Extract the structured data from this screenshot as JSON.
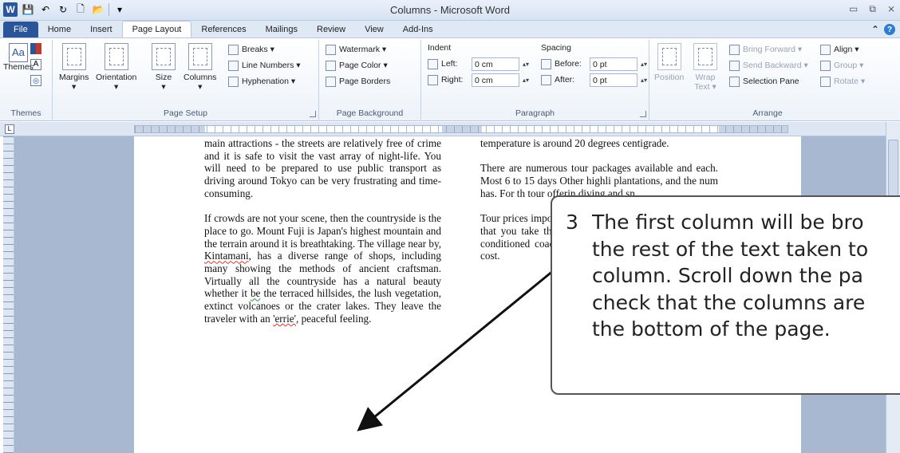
{
  "window": {
    "title": "Columns - Microsoft Word",
    "app_icon": "W"
  },
  "tabs": [
    "File",
    "Home",
    "Insert",
    "Page Layout",
    "References",
    "Mailings",
    "Review",
    "View",
    "Add-Ins"
  ],
  "active_tab": "Page Layout",
  "ribbon": {
    "themes": {
      "label": "Themes",
      "group": "Themes"
    },
    "page_setup": {
      "group": "Page Setup",
      "margins": "Margins",
      "orientation": "Orientation",
      "size": "Size",
      "columns": "Columns",
      "breaks": "Breaks ▾",
      "line_numbers": "Line Numbers ▾",
      "hyphenation": "Hyphenation ▾"
    },
    "page_background": {
      "group": "Page Background",
      "watermark": "Watermark ▾",
      "page_color": "Page Color ▾",
      "page_borders": "Page Borders"
    },
    "paragraph": {
      "group": "Paragraph",
      "indent": "Indent",
      "left_label": "Left:",
      "left_value": "0 cm",
      "right_label": "Right:",
      "right_value": "0 cm",
      "spacing": "Spacing",
      "before_label": "Before:",
      "before_value": "0 pt",
      "after_label": "After:",
      "after_value": "0 pt"
    },
    "arrange": {
      "group": "Arrange",
      "position": "Position",
      "wrap_text": "Wrap Text ▾",
      "bring_forward": "Bring Forward ▾",
      "send_backward": "Send Backward ▾",
      "selection_pane": "Selection Pane",
      "align": "Align ▾",
      "group_btn": "Group ▾",
      "rotate": "Rotate ▾"
    }
  },
  "document": {
    "col1": {
      "p1": "main attractions - the streets are relatively free of crime and it is safe to visit the vast array of night-life.  You will need to be prepared to use public transport as driving around Tokyo can be very frustrating and time-consuming.",
      "p2a": "If crowds are not your scene, then the countryside is the place to go.  Mount Fuji is Japan's highest mountain and the terrain around it is breathtaking.  The village near by, ",
      "p2_kintamani": "Kintamani",
      "p2b": ", has a diverse range of shops, including many showing the methods of ancient craftsman.  Virtually all the countryside has a natural beauty whether it ",
      "p2_be": "be",
      "p2c": " the terraced hillsides, the lush vegetation, extinct volcanoes or the crater lakes.  They leave the traveler with an ",
      "p2_errie": "'errie'",
      "p2d": ", peaceful feeling."
    },
    "col2": {
      "p1": "temperature is around 20 degrees centigrade.",
      "p2": "There are numerous tour packages available and each.  Most 6 to 15 days Other highli plantations, and the num has.  For th tour offerin diving and sn",
      "p3": "Tour prices important to read each brochure carefully so that you take the tour you want.  For instance, an air conditioned coach can add up to 30% on to the tour cost."
    }
  },
  "callout": {
    "number": "3",
    "lines": [
      "The first column will be bro",
      "the rest of the text taken to",
      "column.  Scroll down the pa",
      "check that the columns are",
      "the bottom of the page."
    ]
  }
}
